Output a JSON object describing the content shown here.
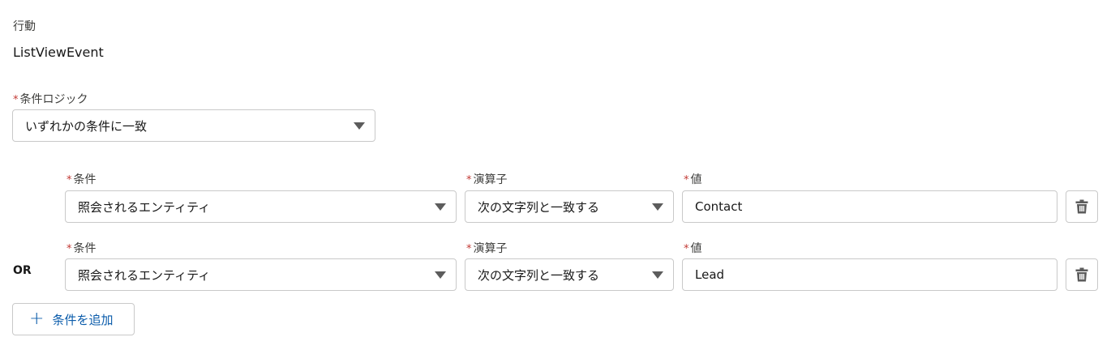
{
  "action": {
    "label": "行動",
    "value": "ListViewEvent"
  },
  "logic": {
    "required_mark": "*",
    "label": "条件ロジック",
    "selected": "いずれかの条件に一致"
  },
  "rows": [
    {
      "connector": "",
      "condition_label": "条件",
      "condition_value": "照会されるエンティティ",
      "operator_label": "演算子",
      "operator_value": "次の文字列と一致する",
      "value_label": "値",
      "value": "Contact"
    },
    {
      "connector": "OR",
      "condition_label": "条件",
      "condition_value": "照会されるエンティティ",
      "operator_label": "演算子",
      "operator_value": "次の文字列と一致する",
      "value_label": "値",
      "value": "Lead"
    }
  ],
  "add_button": {
    "label": "条件を追加"
  },
  "colors": {
    "required": "#c23934",
    "link": "#0b5cab",
    "border": "#c9c9c9"
  }
}
